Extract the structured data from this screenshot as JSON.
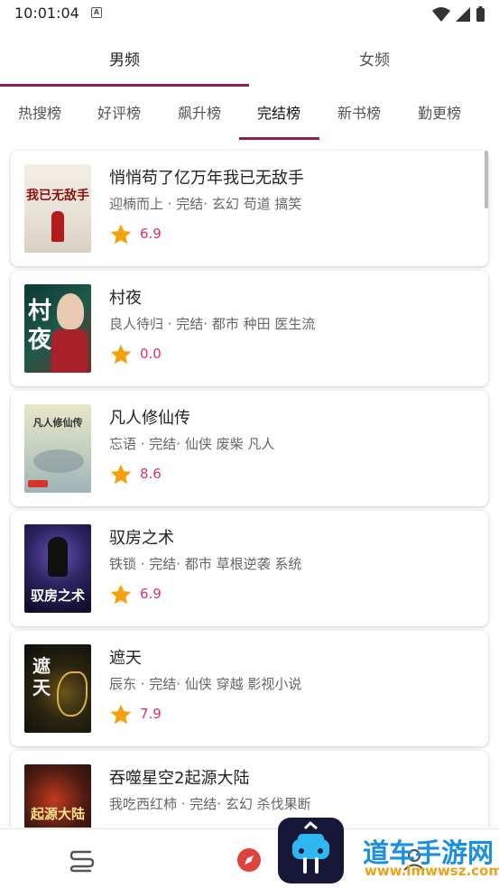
{
  "status_bar": {
    "time": "10:01:04",
    "a_badge": "A"
  },
  "top_tabs": [
    {
      "label": "男频",
      "active": true
    },
    {
      "label": "女频",
      "active": false
    }
  ],
  "sub_tabs": [
    {
      "label": "热搜榜",
      "active": false
    },
    {
      "label": "好评榜",
      "active": false
    },
    {
      "label": "飙升榜",
      "active": false
    },
    {
      "label": "完结榜",
      "active": true
    },
    {
      "label": "新书榜",
      "active": false
    },
    {
      "label": "勤更榜",
      "active": false
    }
  ],
  "books": [
    {
      "title": "悄悄苟了亿万年我已无敌手",
      "meta": "迎楠而上 · 完结· 玄幻 苟道 搞笑",
      "score": "6.9",
      "cover_text": "我已无敌手"
    },
    {
      "title": "村夜",
      "meta": "良人待归 · 完结· 都市 种田 医生流",
      "score": "0.0",
      "cover_text": "村夜"
    },
    {
      "title": "凡人修仙传",
      "meta": "忘语 · 完结· 仙侠 废柴 凡人",
      "score": "8.6",
      "cover_text": "凡人修仙传"
    },
    {
      "title": "驭房之术",
      "meta": "铁锁 · 完结· 都市 草根逆袭 系统",
      "score": "6.9",
      "cover_text": "驭房之术"
    },
    {
      "title": "遮天",
      "meta": "辰东 · 完结· 仙侠 穿越 影视小说",
      "score": "7.9",
      "cover_text": "遮天"
    },
    {
      "title": "吞噬星空2起源大陆",
      "meta": "我吃西红柿 · 完结· 玄幻 杀伐果断",
      "score": "",
      "cover_text": "起源大陆"
    }
  ],
  "bottom_nav": {
    "items": [
      {
        "icon": "bookshelf-icon"
      },
      {
        "icon": "compass-icon"
      },
      {
        "icon": "user-icon"
      }
    ]
  },
  "watermark": {
    "text": "道车手游网",
    "url": "www.lmwwsz.com"
  },
  "colors": {
    "accent": "#8c1d57",
    "score": "#e0306b",
    "star": "#f5a10b"
  }
}
